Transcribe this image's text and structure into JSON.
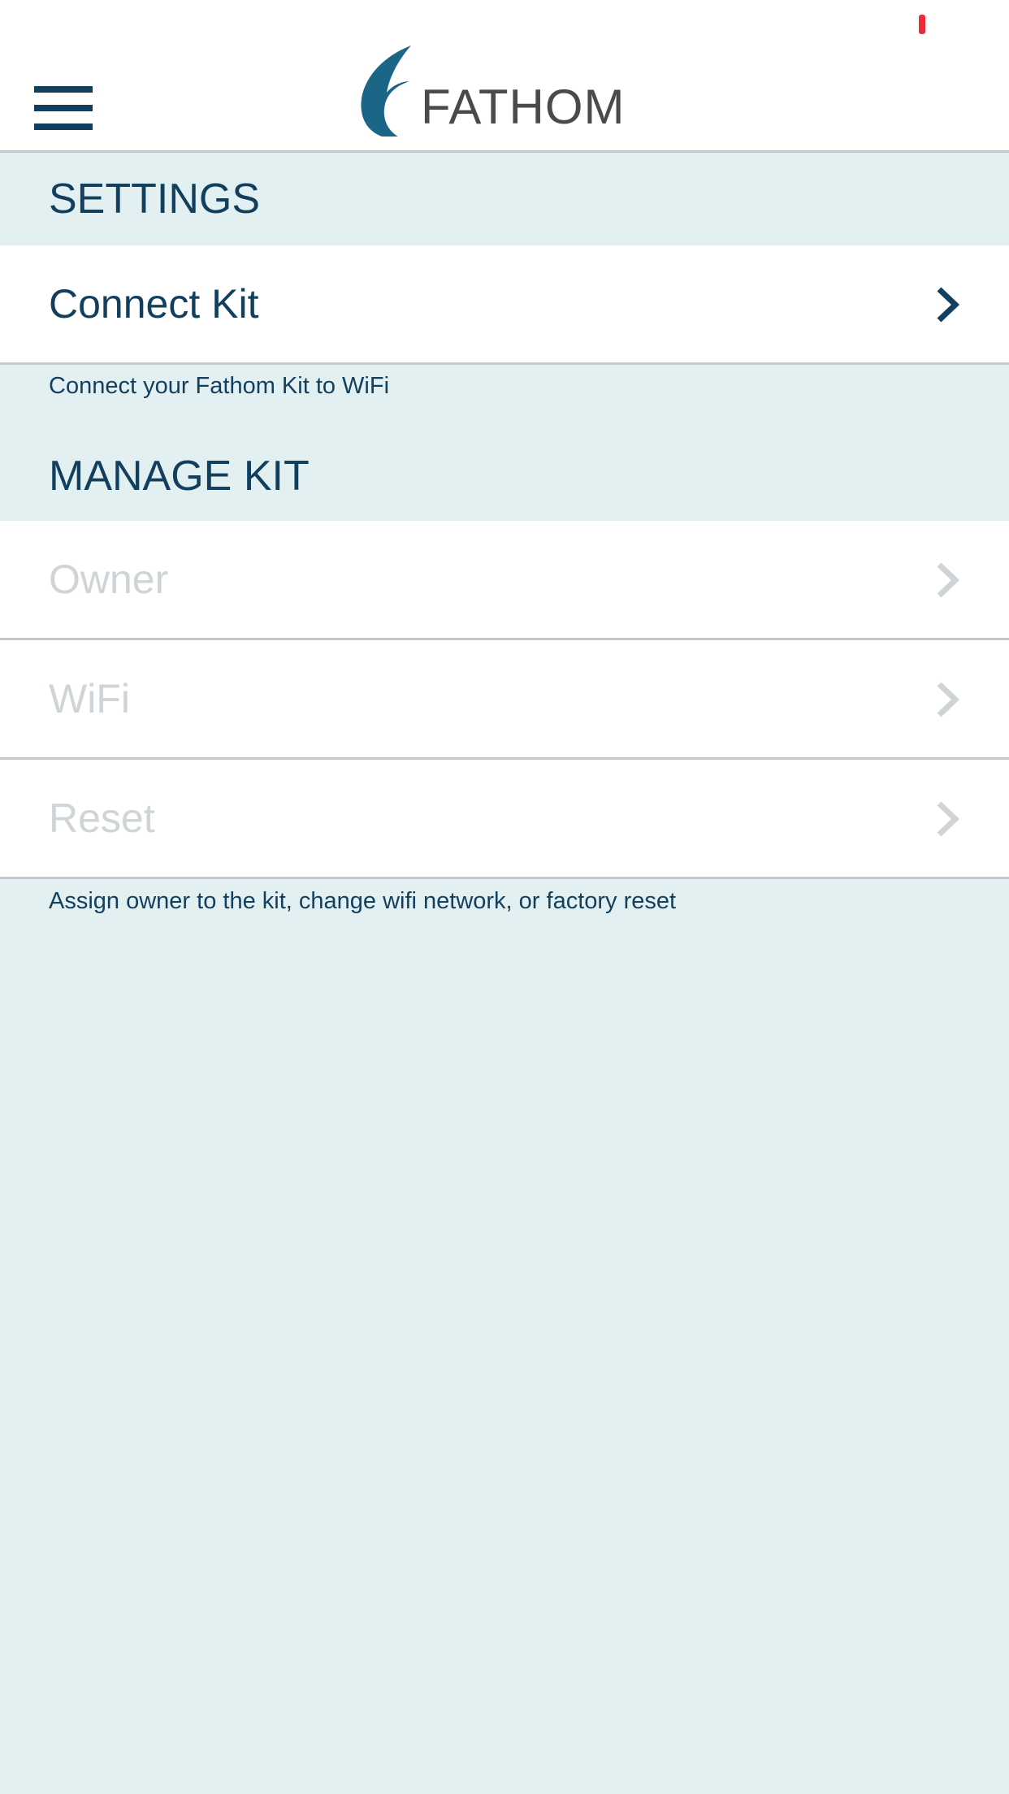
{
  "header": {
    "logo_text": "FATHOM",
    "menu_icon": "hamburger-menu-icon",
    "logo_icon": "fathom-leaf-logo-icon"
  },
  "settings": {
    "title": "SETTINGS",
    "items": [
      {
        "label": "Connect Kit",
        "enabled": true,
        "icon": "chevron-right-icon"
      }
    ],
    "footnote": "Connect your Fathom Kit to WiFi"
  },
  "manage_kit": {
    "title": "MANAGE KIT",
    "items": [
      {
        "label": "Owner",
        "enabled": false,
        "icon": "chevron-right-icon"
      },
      {
        "label": "WiFi",
        "enabled": false,
        "icon": "chevron-right-icon"
      },
      {
        "label": "Reset",
        "enabled": false,
        "icon": "chevron-right-icon"
      }
    ],
    "footnote": "Assign owner to the kit, change wifi network, or factory reset"
  },
  "colors": {
    "primary": "#133f5e",
    "logo_mark": "#1b6587",
    "background": "#e3f0f2",
    "disabled": "#cfd4d7",
    "status_indicator": "#ee2a35"
  }
}
